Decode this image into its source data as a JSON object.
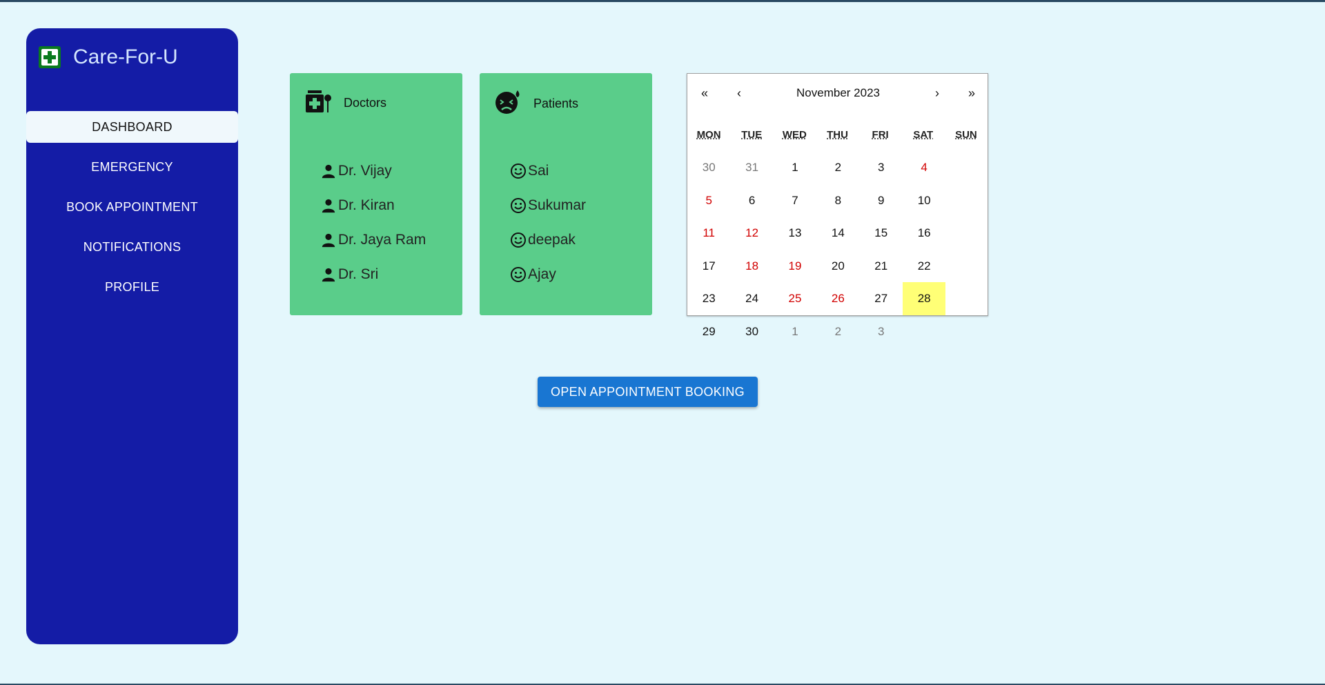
{
  "app": {
    "title": "Care-For-U",
    "logo_icon": "first-aid-icon"
  },
  "sidebar": {
    "items": [
      {
        "label": "DASHBOARD",
        "active": true
      },
      {
        "label": "EMERGENCY"
      },
      {
        "label": "BOOK APPOINTMENT"
      },
      {
        "label": "NOTIFICATIONS"
      },
      {
        "label": "PROFILE"
      }
    ]
  },
  "doctors": {
    "title": "Doctors",
    "icon": "medication-icon",
    "item_icon": "person-icon",
    "items": [
      "Dr. Vijay",
      "Dr. Kiran",
      "Dr. Jaya Ram",
      "Dr. Sri"
    ]
  },
  "patients": {
    "title": "Patients",
    "icon": "sick-face-icon",
    "item_icon": "smiley-icon",
    "items": [
      "Sai",
      "Sukumar",
      "deepak",
      "Ajay"
    ]
  },
  "calendar": {
    "prev_year": "«",
    "prev_month": "‹",
    "month_label": "November 2023",
    "next_month": "›",
    "next_year": "»",
    "weekdays": [
      "MON",
      "TUE",
      "WED",
      "THU",
      "FRI",
      "SAT",
      "SUN"
    ],
    "days": [
      "30",
      "31",
      "1",
      "2",
      "3",
      "4",
      "5",
      "6",
      "7",
      "8",
      "9",
      "10",
      "11",
      "12",
      "13",
      "14",
      "15",
      "16",
      "17",
      "18",
      "19",
      "20",
      "21",
      "22",
      "23",
      "24",
      "25",
      "26",
      "27",
      "28",
      "29",
      "30",
      "1",
      "2",
      "3"
    ],
    "today": "28"
  },
  "action": {
    "open_booking": "OPEN APPOINTMENT BOOKING"
  },
  "colors": {
    "sidebar": "#141ca6",
    "card": "#5acd8a",
    "background": "#e4f7fc",
    "button": "#1976d2",
    "weekend": "#d10000",
    "today": "#ffff76"
  }
}
